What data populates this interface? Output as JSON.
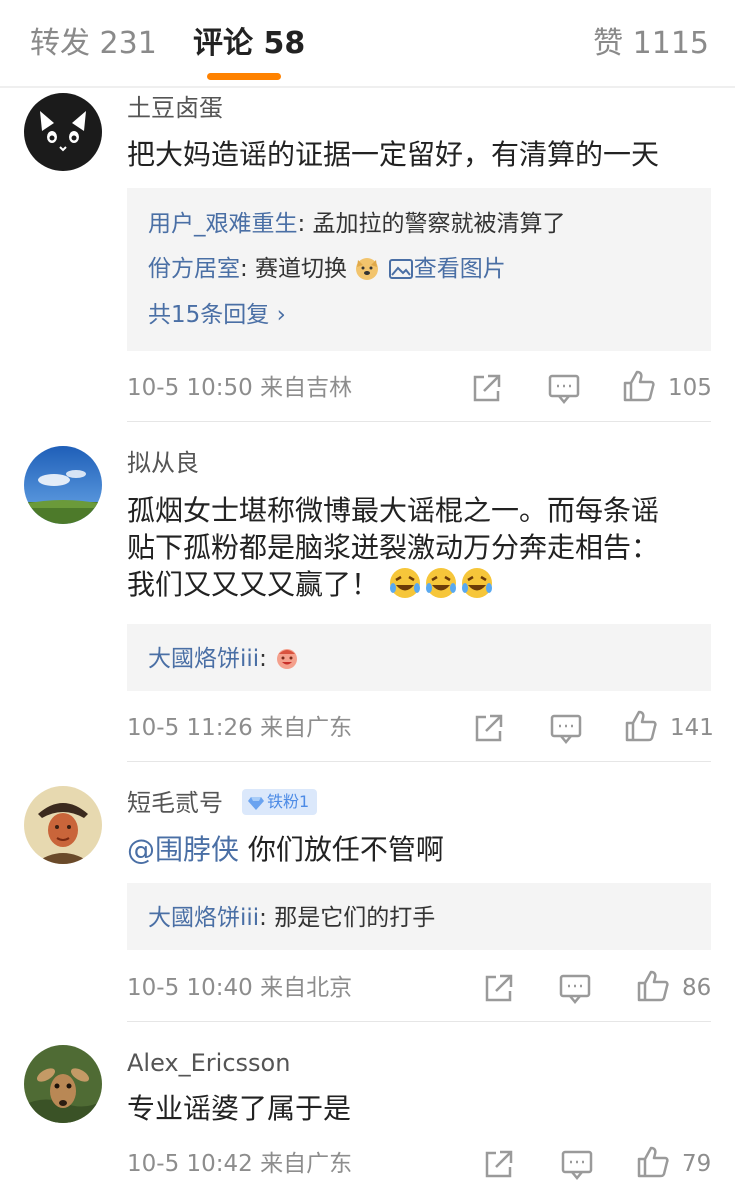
{
  "tabs": {
    "repost": "转发 231",
    "comments": "评论 58",
    "likes": "赞 1115"
  },
  "colors": {
    "accent": "#ff8200",
    "link": "#4a6fa5",
    "muted": "#8d8d8d",
    "reply_background": "#f4f4f4"
  },
  "comments": [
    {
      "username": "土豆卤蛋",
      "avatar_icon": "black-cat-avatar",
      "content": "把大妈造谣的证据一定留好，有清算的一天",
      "replies": [
        {
          "user": "用户_艰难重生",
          "text": ": 孟加拉的警察就被清算了"
        },
        {
          "user": "佾方居室",
          "text": ": 赛道切换",
          "emoji": "doge-emoji",
          "link": "查看图片"
        }
      ],
      "more_replies": "共15条回复 ›",
      "time": "10-5 10:50",
      "source": "来自吉林",
      "likes": "105"
    },
    {
      "username": "拟从良",
      "avatar_icon": "blue-sky-avatar",
      "content_line1": "孤烟女士堪称微博最大谣棍之一。而每条谣",
      "content_line2": "贴下孤粉都是脑浆迸裂激动万分奔走相告：",
      "content_line3": "我们又又又又赢了！",
      "content_emoji": "laughing-tears-emoji",
      "replies": [
        {
          "user": "大國烙饼iii",
          "text": ":",
          "emoji": "smiling-face-emoji"
        }
      ],
      "time": "10-5 11:26",
      "source": "来自广东",
      "likes": "141"
    },
    {
      "username": "短毛贰号",
      "avatar_icon": "portrait-painting-avatar",
      "badge": "铁粉1",
      "mention": "@围脖侠",
      "content": " 你们放任不管啊",
      "replies": [
        {
          "user": "大國烙饼iii",
          "text": ": 那是它们的打手"
        }
      ],
      "time": "10-5 10:40",
      "source": "来自北京",
      "likes": "86"
    },
    {
      "username": "Alex_Ericsson",
      "avatar_icon": "fawn-avatar",
      "content": "专业谣婆了属于是",
      "time": "10-5 10:42",
      "source": "来自广东",
      "likes": "79"
    }
  ]
}
